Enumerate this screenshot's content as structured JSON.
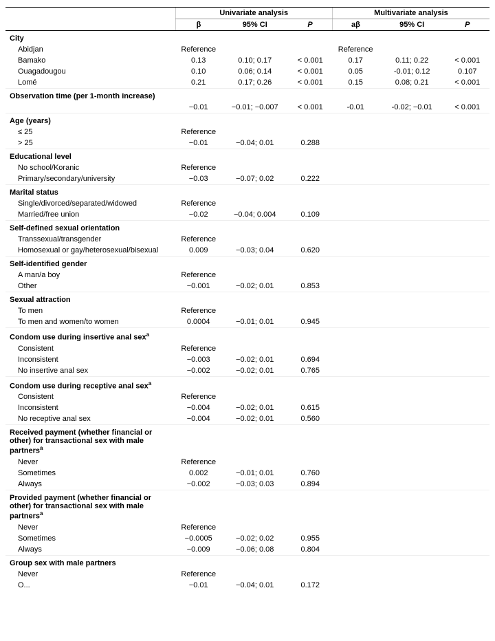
{
  "table": {
    "univariate_label": "Univariate analysis",
    "multivariate_label": "Multivariate analysis",
    "col_beta": "β",
    "col_ci": "95% CI",
    "col_p": "P",
    "col_abeta": "aβ",
    "col_ci2": "95% CI",
    "col_p2": "P",
    "sections": [
      {
        "header": "City",
        "rows": [
          {
            "label": "Abidjan",
            "indent": true,
            "beta": "Reference",
            "ci": "",
            "p": "",
            "abeta": "Reference",
            "ci2": "",
            "p2": ""
          },
          {
            "label": "Bamako",
            "indent": true,
            "beta": "0.13",
            "ci": "0.10; 0.17",
            "p": "< 0.001",
            "abeta": "0.17",
            "ci2": "0.11; 0.22",
            "p2": "< 0.001"
          },
          {
            "label": "Ouagadougou",
            "indent": true,
            "beta": "0.10",
            "ci": "0.06; 0.14",
            "p": "< 0.001",
            "abeta": "0.05",
            "ci2": "-0.01; 0.12",
            "p2": "0.107"
          },
          {
            "label": "Lomé",
            "indent": true,
            "beta": "0.21",
            "ci": "0.17; 0.26",
            "p": "< 0.001",
            "abeta": "0.15",
            "ci2": "0.08; 0.21",
            "p2": "< 0.001"
          }
        ]
      },
      {
        "header": "Observation time (per 1-month increase)",
        "rows": [
          {
            "label": "",
            "indent": false,
            "beta": "−0.01",
            "ci": "−0.01; −0.007",
            "p": "< 0.001",
            "abeta": "-0.01",
            "ci2": "-0.02; −0.01",
            "p2": "< 0.001"
          }
        ]
      },
      {
        "header": "Age (years)",
        "rows": [
          {
            "label": "≤ 25",
            "indent": true,
            "beta": "Reference",
            "ci": "",
            "p": "",
            "abeta": "",
            "ci2": "",
            "p2": ""
          },
          {
            "label": "> 25",
            "indent": true,
            "beta": "−0.01",
            "ci": "−0.04; 0.01",
            "p": "0.288",
            "abeta": "",
            "ci2": "",
            "p2": ""
          }
        ]
      },
      {
        "header": "Educational level",
        "rows": [
          {
            "label": "No school/Koranic",
            "indent": true,
            "beta": "Reference",
            "ci": "",
            "p": "",
            "abeta": "",
            "ci2": "",
            "p2": ""
          },
          {
            "label": "Primary/secondary/university",
            "indent": true,
            "beta": "−0.03",
            "ci": "−0.07; 0.02",
            "p": "0.222",
            "abeta": "",
            "ci2": "",
            "p2": ""
          }
        ]
      },
      {
        "header": "Marital status",
        "rows": [
          {
            "label": "Single/divorced/separated/widowed",
            "indent": true,
            "beta": "Reference",
            "ci": "",
            "p": "",
            "abeta": "",
            "ci2": "",
            "p2": ""
          },
          {
            "label": "Married/free union",
            "indent": true,
            "beta": "−0.02",
            "ci": "−0.04; 0.004",
            "p": "0.109",
            "abeta": "",
            "ci2": "",
            "p2": ""
          }
        ]
      },
      {
        "header": "Self-defined sexual orientation",
        "rows": [
          {
            "label": "Transsexual/transgender",
            "indent": true,
            "beta": "Reference",
            "ci": "",
            "p": "",
            "abeta": "",
            "ci2": "",
            "p2": ""
          },
          {
            "label": "Homosexual or gay/heterosexual/bisexual",
            "indent": true,
            "beta": "0.009",
            "ci": "−0.03; 0.04",
            "p": "0.620",
            "abeta": "",
            "ci2": "",
            "p2": ""
          }
        ]
      },
      {
        "header": "Self-identified gender",
        "rows": [
          {
            "label": "A man/a boy",
            "indent": true,
            "beta": "Reference",
            "ci": "",
            "p": "",
            "abeta": "",
            "ci2": "",
            "p2": ""
          },
          {
            "label": "Other",
            "indent": true,
            "beta": "−0.001",
            "ci": "−0.02; 0.01",
            "p": "0.853",
            "abeta": "",
            "ci2": "",
            "p2": ""
          }
        ]
      },
      {
        "header": "Sexual attraction",
        "rows": [
          {
            "label": "To men",
            "indent": true,
            "beta": "Reference",
            "ci": "",
            "p": "",
            "abeta": "",
            "ci2": "",
            "p2": ""
          },
          {
            "label": "To men and women/to women",
            "indent": true,
            "beta": "0.0004",
            "ci": "−0.01; 0.01",
            "p": "0.945",
            "abeta": "",
            "ci2": "",
            "p2": ""
          }
        ]
      },
      {
        "header": "Condom use during insertive anal sex",
        "header_sup": "a",
        "rows": [
          {
            "label": "Consistent",
            "indent": true,
            "beta": "Reference",
            "ci": "",
            "p": "",
            "abeta": "",
            "ci2": "",
            "p2": ""
          },
          {
            "label": "Inconsistent",
            "indent": true,
            "beta": "−0.003",
            "ci": "−0.02; 0.01",
            "p": "0.694",
            "abeta": "",
            "ci2": "",
            "p2": ""
          },
          {
            "label": "No insertive anal sex",
            "indent": true,
            "beta": "−0.002",
            "ci": "−0.02; 0.01",
            "p": "0.765",
            "abeta": "",
            "ci2": "",
            "p2": ""
          }
        ]
      },
      {
        "header": "Condom use during receptive anal sex",
        "header_sup": "a",
        "rows": [
          {
            "label": "Consistent",
            "indent": true,
            "beta": "Reference",
            "ci": "",
            "p": "",
            "abeta": "",
            "ci2": "",
            "p2": ""
          },
          {
            "label": "Inconsistent",
            "indent": true,
            "beta": "−0.004",
            "ci": "−0.02; 0.01",
            "p": "0.615",
            "abeta": "",
            "ci2": "",
            "p2": ""
          },
          {
            "label": "No receptive anal sex",
            "indent": true,
            "beta": "−0.004",
            "ci": "−0.02; 0.01",
            "p": "0.560",
            "abeta": "",
            "ci2": "",
            "p2": ""
          }
        ]
      },
      {
        "header": "Received payment (whether financial or other) for transactional sex with male partners",
        "header_sup": "a",
        "rows": [
          {
            "label": "Never",
            "indent": true,
            "beta": "Reference",
            "ci": "",
            "p": "",
            "abeta": "",
            "ci2": "",
            "p2": ""
          },
          {
            "label": "Sometimes",
            "indent": true,
            "beta": "0.002",
            "ci": "−0.01; 0.01",
            "p": "0.760",
            "abeta": "",
            "ci2": "",
            "p2": ""
          },
          {
            "label": "Always",
            "indent": true,
            "beta": "−0.002",
            "ci": "−0.03; 0.03",
            "p": "0.894",
            "abeta": "",
            "ci2": "",
            "p2": ""
          }
        ]
      },
      {
        "header": "Provided payment (whether financial or other) for transactional sex with male partners",
        "header_sup": "a",
        "rows": [
          {
            "label": "Never",
            "indent": true,
            "beta": "Reference",
            "ci": "",
            "p": "",
            "abeta": "",
            "ci2": "",
            "p2": ""
          },
          {
            "label": "Sometimes",
            "indent": true,
            "beta": "−0.0005",
            "ci": "−0.02; 0.02",
            "p": "0.955",
            "abeta": "",
            "ci2": "",
            "p2": ""
          },
          {
            "label": "Always",
            "indent": true,
            "beta": "−0.009",
            "ci": "−0.06; 0.08",
            "p": "0.804",
            "abeta": "",
            "ci2": "",
            "p2": ""
          }
        ]
      },
      {
        "header": "Group sex with male partners",
        "rows": [
          {
            "label": "Never",
            "indent": true,
            "beta": "Reference",
            "ci": "",
            "p": "",
            "abeta": "",
            "ci2": "",
            "p2": ""
          },
          {
            "label": "O...",
            "indent": true,
            "beta": "−0.01",
            "ci": "−0.04; 0.01",
            "p": "0.172",
            "abeta": "",
            "ci2": "",
            "p2": ""
          }
        ]
      }
    ]
  }
}
